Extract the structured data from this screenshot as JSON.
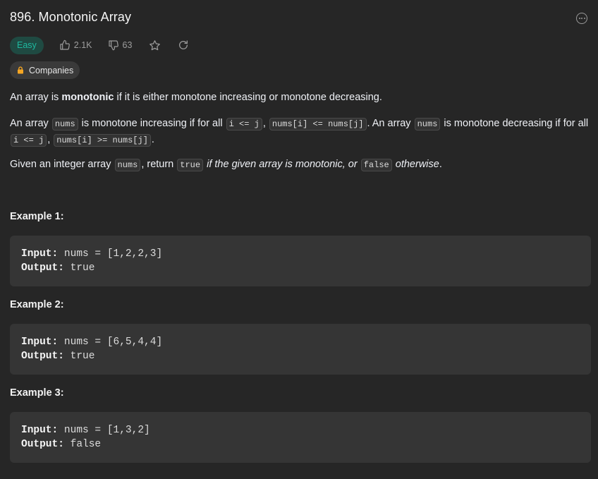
{
  "problem": {
    "title": "896. Monotonic Array",
    "difficulty": "Easy",
    "likes": "2.1K",
    "dislikes": "63",
    "companies_label": "Companies"
  },
  "colors": {
    "background": "#262626",
    "easy": "#1fb89f",
    "easy_bg": "#1f4a42",
    "lock": "#f5a623"
  },
  "icons": [
    "more-icon",
    "thumbs-up-icon",
    "thumbs-down-icon",
    "star-icon",
    "refresh-icon",
    "lock-icon"
  ],
  "description": {
    "p1": {
      "a": "An array is ",
      "b": "monotonic",
      "c": " if it is either monotone increasing or monotone decreasing."
    },
    "p2": {
      "t1": "An array ",
      "c1": "nums",
      "t2": " is monotone increasing if for all ",
      "c2": "i <= j",
      "t3": ", ",
      "c3": "nums[i] <= nums[j]",
      "t4": ". An array ",
      "c4": "nums",
      "t5": " is monotone decreasing if for all ",
      "c5": "i <= j",
      "t6": ", ",
      "c6": "nums[i] >= nums[j]",
      "t7": "."
    },
    "p3": {
      "t1": "Given an integer array ",
      "c1": "nums",
      "t2": ", return ",
      "c2": "true",
      "e1": " if the given array is monotonic, or ",
      "c3": "false",
      "e2": " otherwise",
      "t3": "."
    }
  },
  "examples": [
    {
      "heading": "Example 1:",
      "input_label": "Input:",
      "input": " nums = [1,2,2,3]",
      "output_label": "Output:",
      "output": " true"
    },
    {
      "heading": "Example 2:",
      "input_label": "Input:",
      "input": " nums = [6,5,4,4]",
      "output_label": "Output:",
      "output": " true"
    },
    {
      "heading": "Example 3:",
      "input_label": "Input:",
      "input": " nums = [1,3,2]",
      "output_label": "Output:",
      "output": " false"
    }
  ]
}
